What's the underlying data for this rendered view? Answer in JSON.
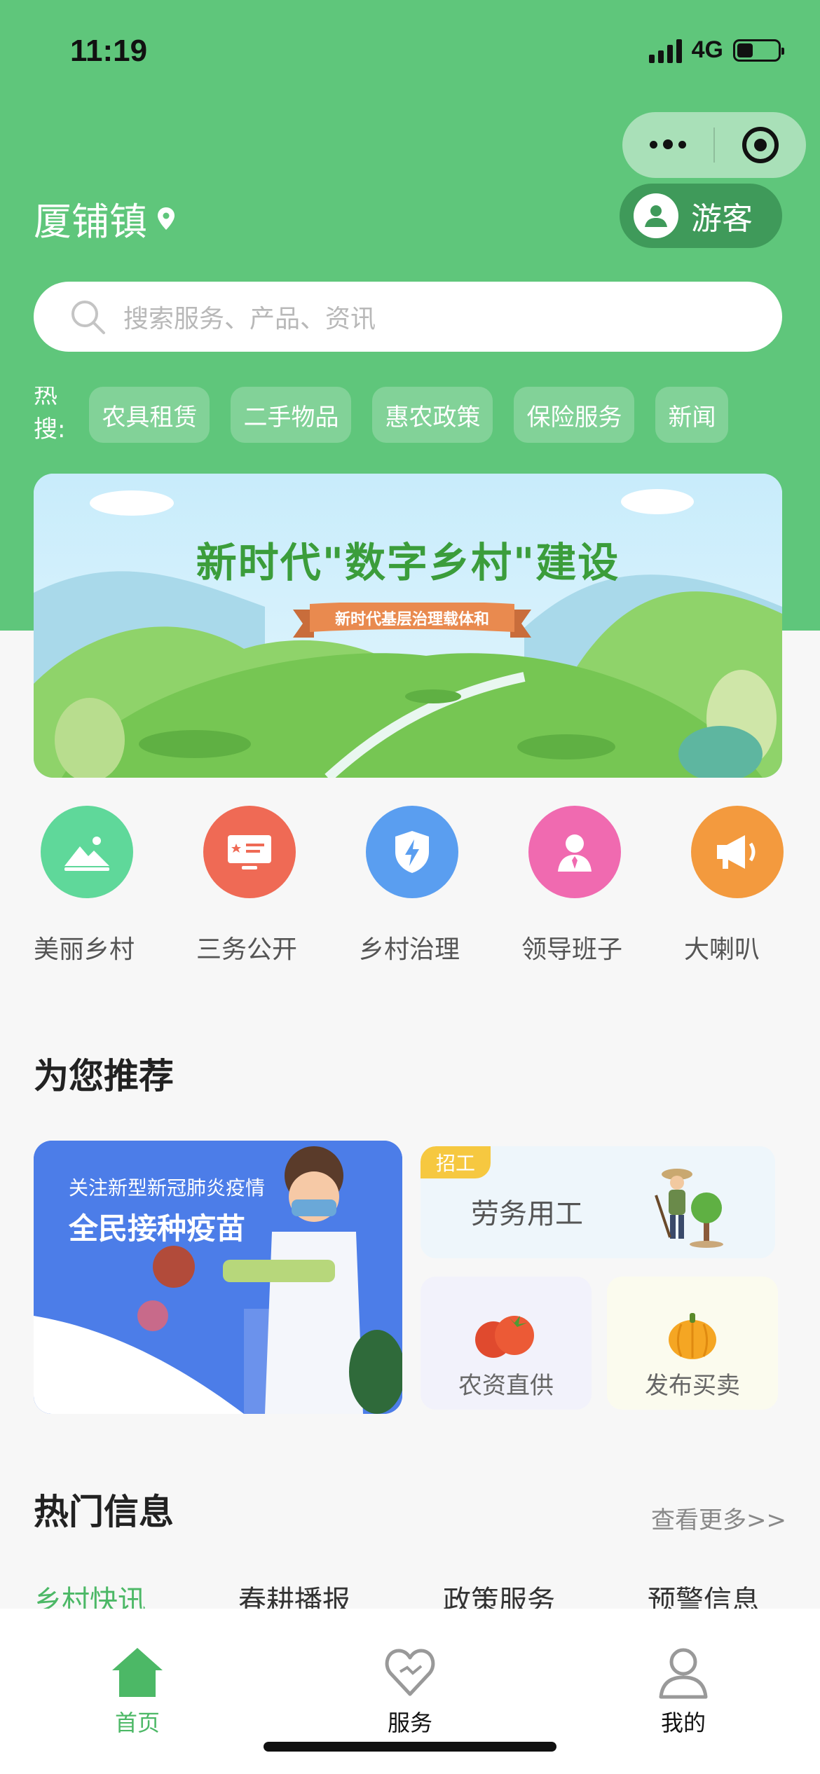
{
  "status_bar": {
    "time": "11:19",
    "network": "4G",
    "battery_level": 0.4
  },
  "header": {
    "location": "厦铺镇",
    "guest_label": "游客"
  },
  "search": {
    "placeholder": "搜索服务、产品、资讯"
  },
  "hot_search": {
    "label": "热搜:",
    "chips": [
      "农具租赁",
      "二手物品",
      "惠农政策",
      "保险服务",
      "新闻"
    ]
  },
  "banner": {
    "title": "新时代\"数字乡村\"建设",
    "ribbon": "新时代基层治理载体和"
  },
  "services": [
    {
      "label": "美丽乡村",
      "icon": "mountain-icon",
      "color": "#5fd89a"
    },
    {
      "label": "三务公开",
      "icon": "notice-board-icon",
      "color": "#ef6a55"
    },
    {
      "label": "乡村治理",
      "icon": "shield-bolt-icon",
      "color": "#5a9ef0"
    },
    {
      "label": "领导班子",
      "icon": "leader-icon",
      "color": "#f06ab0"
    },
    {
      "label": "大喇叭",
      "icon": "megaphone-icon",
      "color": "#f39a3e"
    }
  ],
  "recommend": {
    "title": "为您推荐",
    "big_card": {
      "subtitle": "关注新型新冠肺炎疫情",
      "title": "全民接种疫苗"
    },
    "wide_card": {
      "tag": "招工",
      "label": "劳务用工"
    },
    "small_cards": [
      {
        "label": "农资直供"
      },
      {
        "label": "发布买卖"
      }
    ]
  },
  "hot_info": {
    "title": "热门信息",
    "more": "查看更多>>",
    "tabs": [
      "乡村快讯",
      "春耕播报",
      "政策服务",
      "预警信息"
    ]
  },
  "tabbar": {
    "items": [
      {
        "label": "首页",
        "active": true
      },
      {
        "label": "服务",
        "active": false
      },
      {
        "label": "我的",
        "active": false
      }
    ]
  },
  "colors": {
    "brand": "#5fc67b",
    "accent": "#4cb866"
  }
}
